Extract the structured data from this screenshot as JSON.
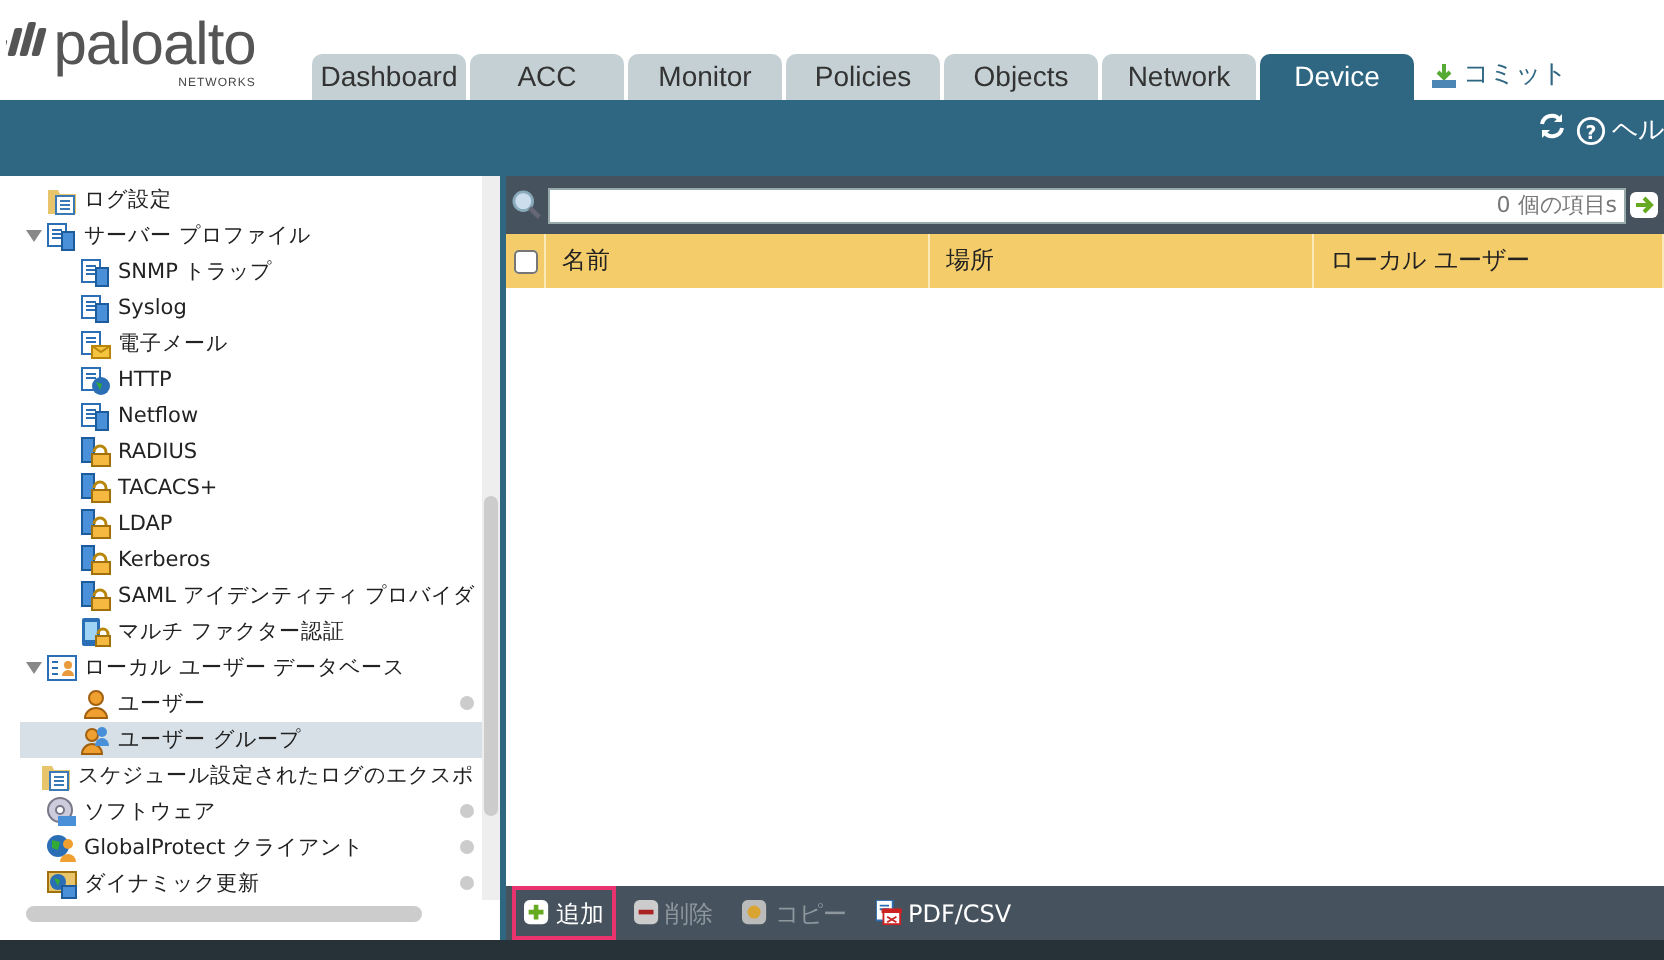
{
  "logo": {
    "name": "paloalto",
    "sub": "NETWORKS"
  },
  "tabs": [
    {
      "label": "Dashboard",
      "selected": false
    },
    {
      "label": "ACC",
      "selected": false
    },
    {
      "label": "Monitor",
      "selected": false
    },
    {
      "label": "Policies",
      "selected": false
    },
    {
      "label": "Objects",
      "selected": false
    },
    {
      "label": "Network",
      "selected": false
    },
    {
      "label": "Device",
      "selected": true
    }
  ],
  "commit": "コミット",
  "help_glyph": "?",
  "help": "ヘル",
  "tree": [
    {
      "label": "ログ設定",
      "kind": "doc",
      "selected": false,
      "dot": false
    },
    {
      "label": "サーバー プロファイル",
      "kind": "server",
      "selected": false,
      "dot": false,
      "expanded": true,
      "children": [
        {
          "label": "SNMP トラップ",
          "kind": "server",
          "selected": false,
          "dot": false
        },
        {
          "label": "Syslog",
          "kind": "server",
          "selected": false,
          "dot": false
        },
        {
          "label": "電子メール",
          "kind": "mail",
          "selected": false,
          "dot": false
        },
        {
          "label": "HTTP",
          "kind": "web",
          "selected": false,
          "dot": false
        },
        {
          "label": "Netflow",
          "kind": "server",
          "selected": false,
          "dot": false
        },
        {
          "label": "RADIUS",
          "kind": "lock",
          "selected": false,
          "dot": false
        },
        {
          "label": "TACACS+",
          "kind": "lock",
          "selected": false,
          "dot": false
        },
        {
          "label": "LDAP",
          "kind": "lock",
          "selected": false,
          "dot": false
        },
        {
          "label": "Kerberos",
          "kind": "lock",
          "selected": false,
          "dot": false
        },
        {
          "label": "SAML アイデンティティ プロバイダ",
          "kind": "lock",
          "selected": false,
          "dot": false
        },
        {
          "label": "マルチ ファクター認証",
          "kind": "mfa",
          "selected": false,
          "dot": false
        }
      ]
    },
    {
      "label": "ローカル ユーザー データベース",
      "kind": "database",
      "selected": false,
      "dot": false,
      "expanded": true,
      "children": [
        {
          "label": "ユーザー",
          "kind": "user",
          "selected": false,
          "dot": true
        },
        {
          "label": "ユーザー グループ",
          "kind": "group",
          "selected": true,
          "dot": false
        }
      ]
    },
    {
      "label": "スケジュール設定されたログのエクスポ",
      "kind": "doc",
      "selected": false,
      "dot": false
    },
    {
      "label": "ソフトウェア",
      "kind": "disc",
      "selected": false,
      "dot": true
    },
    {
      "label": "GlobalProtect クライアント",
      "kind": "globe",
      "selected": false,
      "dot": true
    },
    {
      "label": "ダイナミック更新",
      "kind": "update",
      "selected": false,
      "dot": true
    }
  ],
  "search": {
    "count": "0 個の項目s"
  },
  "table": {
    "columns": [
      "名前",
      "場所",
      "ローカル ユーザー"
    ],
    "all_checked": false
  },
  "actions": [
    {
      "label": "追加",
      "kind": "add",
      "disabled": false,
      "highlighted": true
    },
    {
      "label": "削除",
      "kind": "delete",
      "disabled": true,
      "highlighted": false
    },
    {
      "label": "コピー",
      "kind": "copy",
      "disabled": true,
      "highlighted": false
    },
    {
      "label": "PDF/CSV",
      "kind": "pdf",
      "disabled": false,
      "highlighted": false
    }
  ]
}
